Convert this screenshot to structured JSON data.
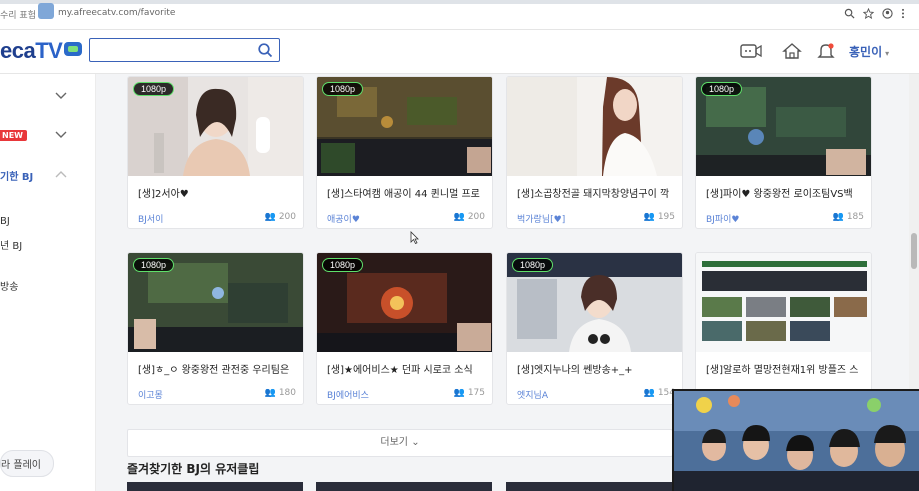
{
  "browser": {
    "crumb": "수리 표험",
    "url": "my.afreecatv.com/favorite",
    "icons": [
      "zoom-icon",
      "star-icon",
      "account-icon",
      "menu-icon"
    ]
  },
  "header": {
    "logo": "eca",
    "logo_tv": "TV",
    "search_placeholder": "",
    "user_name": "홍민이",
    "icons": [
      "broadcast-icon",
      "home-icon",
      "bell-icon"
    ],
    "accent": "#3a62b8"
  },
  "sidebar": {
    "new_badge": "NEW",
    "items": [
      {
        "label": "기한 BJ",
        "active": true
      },
      {
        "label": "BJ",
        "active": false
      },
      {
        "label": "년 BJ",
        "active": false
      },
      {
        "label": "방송",
        "active": false
      }
    ],
    "bottom_button": "라 플레이"
  },
  "cards": [
    {
      "badge": "1080p",
      "title": "[생]2서아♥",
      "bj": "BJ서이",
      "viewers": "200"
    },
    {
      "badge": "1080p",
      "title": "[생]스타여캠 애공이 44 퀸니멀 프로",
      "bj": "애공이♥",
      "viewers": "200"
    },
    {
      "badge": "",
      "title": "[생]소곱창전골 돼지막창양념구이 깍",
      "bj": "벅가랑님[♥]",
      "viewers": "195"
    },
    {
      "badge": "1080p",
      "title": "[생]파이♥ 왕중왕전 로이조팀VS백",
      "bj": "BJ파이♥",
      "viewers": "185"
    },
    {
      "badge": "1080p",
      "title": "[생]ㅎ_ㅇ 왕중왕전 관전중 우리팀은",
      "bj": "이고몽",
      "viewers": "180"
    },
    {
      "badge": "1080p",
      "title": "[생]★에어비스★ 던파 시로코 소식",
      "bj": "BJ에어비스",
      "viewers": "175"
    },
    {
      "badge": "1080p",
      "title": "[생]엣지누나의 쎈방송+_+",
      "bj": "엣지님A",
      "viewers": "154"
    },
    {
      "badge": "",
      "title": "[생]알로하 멸망전현재1위 방플즈 스",
      "bj": "",
      "viewers": ""
    }
  ],
  "more_button": "더보기",
  "section_title": "즐겨찾기한 BJ의 유저클립"
}
